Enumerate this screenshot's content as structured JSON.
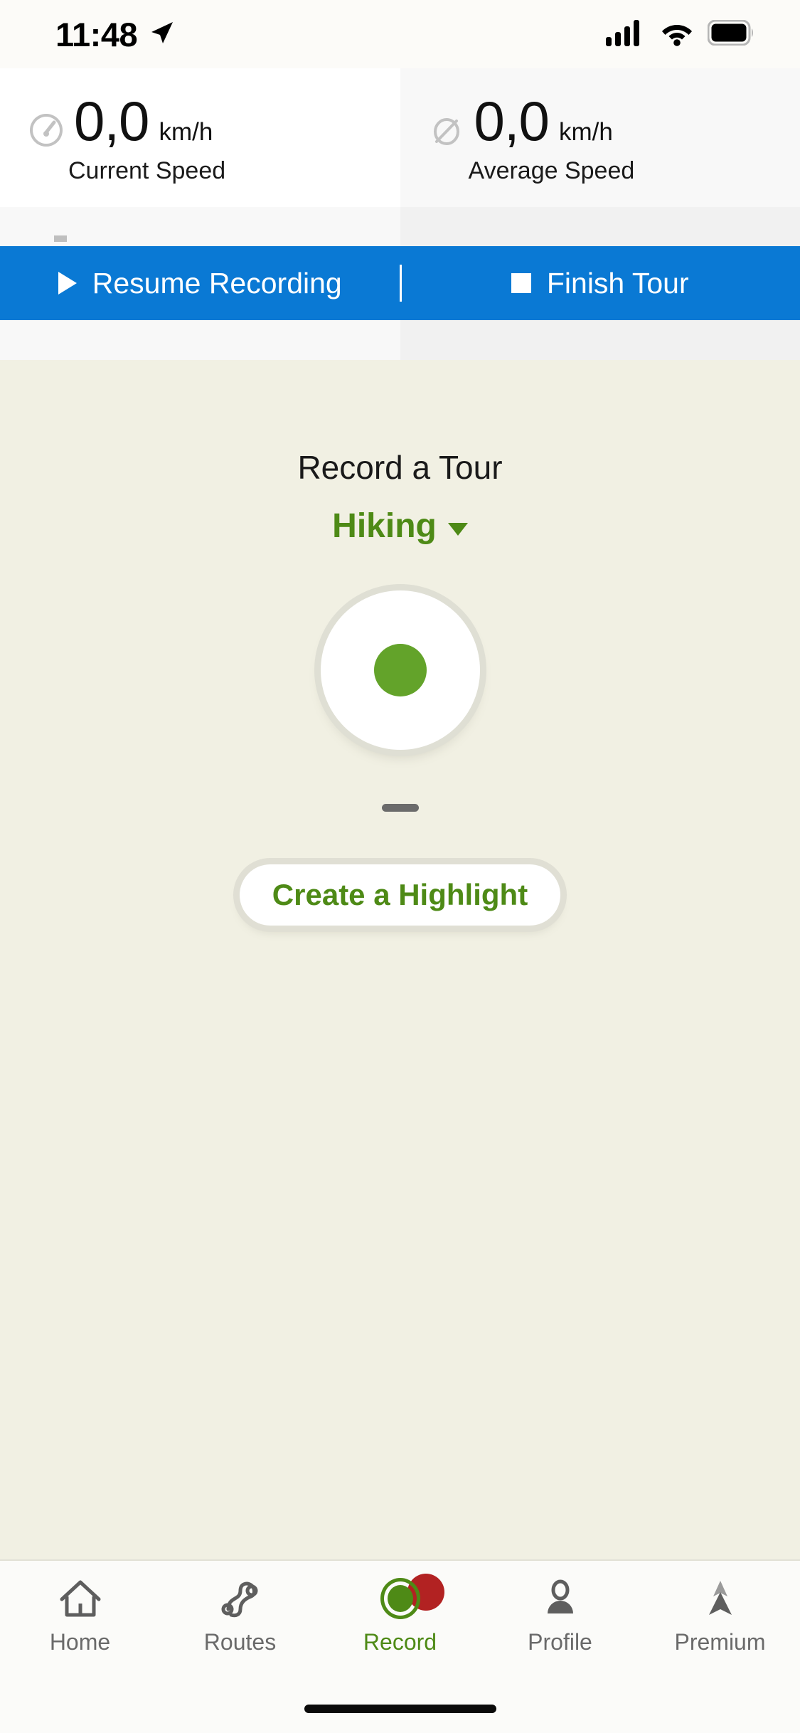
{
  "status_bar": {
    "time": "11:48",
    "location_icon": "location-arrow-icon",
    "cellular_icon": "cellular-signal-icon",
    "wifi_icon": "wifi-icon",
    "battery_icon": "battery-full-icon"
  },
  "stats": [
    {
      "icon": "speedometer-icon",
      "value": "0,0",
      "unit": "km/h",
      "label": "Current Speed"
    },
    {
      "icon": "average-diameter-icon",
      "value": "0,0",
      "unit": "km/h",
      "label": "Average Speed"
    }
  ],
  "action_bar": {
    "background_color": "#0A79D4",
    "resume": {
      "icon": "play-icon",
      "label": "Resume Recording"
    },
    "finish": {
      "icon": "stop-icon",
      "label": "Finish Tour"
    }
  },
  "main": {
    "background_color": "#F1F0E3",
    "title": "Record a Tour",
    "sport": {
      "label": "Hiking",
      "accent_color": "#4E8A16",
      "caret_icon": "chevron-down-icon"
    },
    "record_button": {
      "name": "record-button",
      "dot_color": "#63A32A"
    },
    "drag_handle": "drag-handle",
    "highlight_button": {
      "label": "Create a Highlight",
      "text_color": "#4E8A16"
    }
  },
  "tabbar": {
    "active_color": "#4E8A16",
    "inactive_color": "#6A6A6A",
    "badge_color": "#B22222",
    "items": [
      {
        "id": "home",
        "label": "Home",
        "icon": "home-icon",
        "active": false
      },
      {
        "id": "routes",
        "label": "Routes",
        "icon": "routes-icon",
        "active": false
      },
      {
        "id": "record",
        "label": "Record",
        "icon": "record-icon",
        "active": true
      },
      {
        "id": "profile",
        "label": "Profile",
        "icon": "profile-icon",
        "active": false
      },
      {
        "id": "premium",
        "label": "Premium",
        "icon": "premium-icon",
        "active": false
      }
    ]
  }
}
